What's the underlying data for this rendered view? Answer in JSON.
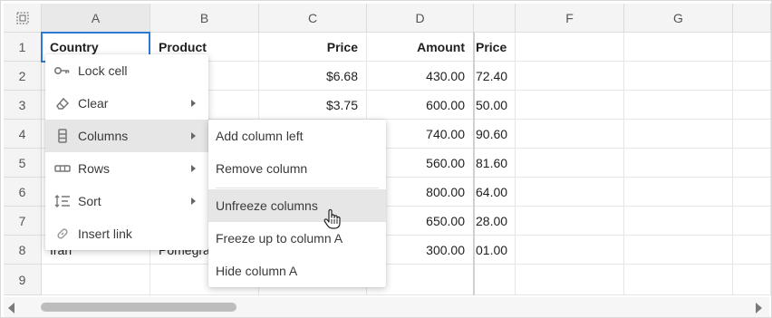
{
  "columns": [
    "A",
    "B",
    "C",
    "D",
    "",
    "F",
    "G"
  ],
  "rows": [
    "1",
    "2",
    "3",
    "4",
    "5",
    "6",
    "7",
    "8",
    "9"
  ],
  "grid": {
    "header_row": [
      "Country",
      "Product",
      "Price",
      "Amount",
      "Price"
    ],
    "country": [
      "",
      "",
      "",
      "",
      "",
      "",
      "Iran"
    ],
    "product": [
      "",
      "",
      "",
      "",
      "",
      "",
      "Pomegra"
    ],
    "price": [
      "$6.68",
      "$3.75",
      "",
      "",
      "",
      "",
      ""
    ],
    "amount": [
      "430.00",
      "600.00",
      "740.00",
      "560.00",
      "800.00",
      "650.00",
      "300.00"
    ],
    "price2": [
      "72.40",
      "50.00",
      "90.60",
      "81.60",
      "64.00",
      "28.00",
      "01.00"
    ]
  },
  "context_menu": {
    "items": [
      {
        "label": "Lock cell",
        "icon": "key-icon"
      },
      {
        "label": "Clear",
        "icon": "eraser-icon"
      },
      {
        "label": "Columns",
        "icon": "columns-icon"
      },
      {
        "label": "Rows",
        "icon": "rows-icon"
      },
      {
        "label": "Sort",
        "icon": "sort-icon"
      },
      {
        "label": "Insert link",
        "icon": "link-icon"
      }
    ]
  },
  "submenu": {
    "items": [
      "Add column left",
      "Remove column",
      "Unfreeze columns",
      "Freeze up to column A",
      "Hide column A"
    ]
  },
  "colors": {
    "accent": "#2b7bd6",
    "highlight": "#e6e6e6",
    "header_bg": "#f4f4f4"
  }
}
